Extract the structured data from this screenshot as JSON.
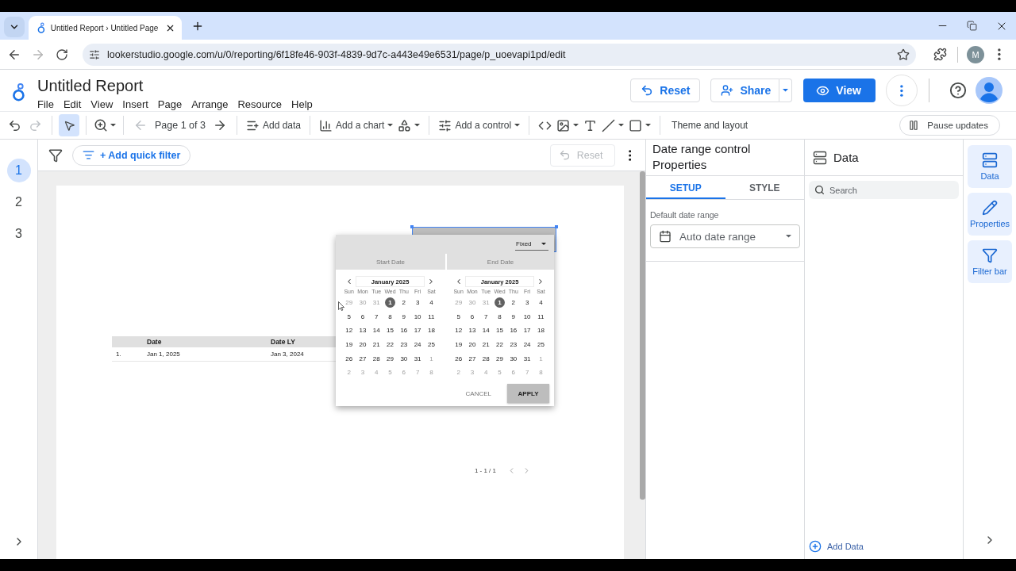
{
  "browser": {
    "tab_title": "Untitled Report › Untitled Page",
    "url": "lookerstudio.google.com/u/0/reporting/6f18fe46-903f-4839-9d7c-a443e49e6531/page/p_uoevapi1pd/edit",
    "profile": "M",
    "forward_disabled": true
  },
  "header": {
    "title": "Untitled Report",
    "menu": [
      "File",
      "Edit",
      "View",
      "Insert",
      "Page",
      "Arrange",
      "Resource",
      "Help"
    ],
    "actions": [
      {
        "kind": "reset",
        "label": "Reset"
      },
      {
        "kind": "share",
        "label": "Share"
      },
      {
        "kind": "view",
        "label": "View"
      }
    ]
  },
  "toolbar": {
    "history": [
      {
        "kind": "undo",
        "disabled": false
      },
      {
        "kind": "redo",
        "disabled": true
      }
    ],
    "select": {
      "selected": true
    },
    "pager": {
      "label": "Page 1 of 3",
      "prev_disabled": true,
      "next_disabled": false
    },
    "insert_groups": [
      [
        {
          "kind": "add-data",
          "label": "Add data",
          "caret": false
        }
      ],
      [
        {
          "kind": "chart",
          "label": "Add a chart",
          "caret": true
        },
        {
          "kind": "components",
          "caret": true
        }
      ],
      [
        {
          "kind": "control",
          "label": "Add a control",
          "caret": true
        }
      ],
      [
        {
          "kind": "embed",
          "caret": false
        },
        {
          "kind": "image",
          "caret": true
        },
        {
          "kind": "text",
          "caret": false
        },
        {
          "kind": "line",
          "caret": true
        },
        {
          "kind": "shape",
          "caret": true
        }
      ]
    ],
    "theme": "Theme and layout",
    "pause": "Pause updates"
  },
  "pages": [
    {
      "label": "1",
      "selected": true
    },
    {
      "label": "2",
      "selected": false
    },
    {
      "label": "3",
      "selected": false
    }
  ],
  "filter_bar": {
    "add_filter": "+ Add quick filter",
    "reset": {
      "label": "Reset",
      "disabled": true
    }
  },
  "report": {
    "table": {
      "columns": [
        "Date",
        "Date LY"
      ],
      "rows": [
        {
          "index": "1.",
          "cells": [
            "Jan 1, 2025",
            "Jan 3, 2024"
          ]
        }
      ],
      "pagination": "1 - 1 / 1"
    },
    "date_control": {
      "selected": true
    },
    "date_picker": {
      "mode": "Fixed",
      "calendars": [
        {
          "heading": "Start Date",
          "month": "January 2025",
          "weekdays": [
            "Sun",
            "Mon",
            "Tue",
            "Wed",
            "Thu",
            "Fri",
            "Sat"
          ],
          "weeks": [
            [
              {
                "label": "29",
                "muted": true,
                "selected": false
              },
              {
                "label": "30",
                "muted": true,
                "selected": false
              },
              {
                "label": "31",
                "muted": true,
                "selected": false
              },
              {
                "label": "1",
                "muted": false,
                "selected": true
              },
              {
                "label": "2",
                "muted": false,
                "selected": false
              },
              {
                "label": "3",
                "muted": false,
                "selected": false
              },
              {
                "label": "4",
                "muted": false,
                "selected": false
              }
            ],
            [
              {
                "label": "5",
                "muted": false,
                "selected": false
              },
              {
                "label": "6",
                "muted": false,
                "selected": false
              },
              {
                "label": "7",
                "muted": false,
                "selected": false
              },
              {
                "label": "8",
                "muted": false,
                "selected": false
              },
              {
                "label": "9",
                "muted": false,
                "selected": false
              },
              {
                "label": "10",
                "muted": false,
                "selected": false
              },
              {
                "label": "11",
                "muted": false,
                "selected": false
              }
            ],
            [
              {
                "label": "12",
                "muted": false,
                "selected": false
              },
              {
                "label": "13",
                "muted": false,
                "selected": false
              },
              {
                "label": "14",
                "muted": false,
                "selected": false
              },
              {
                "label": "15",
                "muted": false,
                "selected": false
              },
              {
                "label": "16",
                "muted": false,
                "selected": false
              },
              {
                "label": "17",
                "muted": false,
                "selected": false
              },
              {
                "label": "18",
                "muted": false,
                "selected": false
              }
            ],
            [
              {
                "label": "19",
                "muted": false,
                "selected": false
              },
              {
                "label": "20",
                "muted": false,
                "selected": false
              },
              {
                "label": "21",
                "muted": false,
                "selected": false
              },
              {
                "label": "22",
                "muted": false,
                "selected": false
              },
              {
                "label": "23",
                "muted": false,
                "selected": false
              },
              {
                "label": "24",
                "muted": false,
                "selected": false
              },
              {
                "label": "25",
                "muted": false,
                "selected": false
              }
            ],
            [
              {
                "label": "26",
                "muted": false,
                "selected": false
              },
              {
                "label": "27",
                "muted": false,
                "selected": false
              },
              {
                "label": "28",
                "muted": false,
                "selected": false
              },
              {
                "label": "29",
                "muted": false,
                "selected": false
              },
              {
                "label": "30",
                "muted": false,
                "selected": false
              },
              {
                "label": "31",
                "muted": false,
                "selected": false
              },
              {
                "label": "1",
                "muted": true,
                "selected": false
              }
            ],
            [
              {
                "label": "2",
                "muted": true,
                "selected": false
              },
              {
                "label": "3",
                "muted": true,
                "selected": false
              },
              {
                "label": "4",
                "muted": true,
                "selected": false
              },
              {
                "label": "5",
                "muted": true,
                "selected": false
              },
              {
                "label": "6",
                "muted": true,
                "selected": false
              },
              {
                "label": "7",
                "muted": true,
                "selected": false
              },
              {
                "label": "8",
                "muted": true,
                "selected": false
              }
            ]
          ]
        },
        {
          "heading": "End Date",
          "month": "January 2025",
          "weekdays": [
            "Sun",
            "Mon",
            "Tue",
            "Wed",
            "Thu",
            "Fri",
            "Sat"
          ],
          "weeks": [
            [
              {
                "label": "29",
                "muted": true,
                "selected": false
              },
              {
                "label": "30",
                "muted": true,
                "selected": false
              },
              {
                "label": "31",
                "muted": true,
                "selected": false
              },
              {
                "label": "1",
                "muted": false,
                "selected": true
              },
              {
                "label": "2",
                "muted": false,
                "selected": false
              },
              {
                "label": "3",
                "muted": false,
                "selected": false
              },
              {
                "label": "4",
                "muted": false,
                "selected": false
              }
            ],
            [
              {
                "label": "5",
                "muted": false,
                "selected": false
              },
              {
                "label": "6",
                "muted": false,
                "selected": false
              },
              {
                "label": "7",
                "muted": false,
                "selected": false
              },
              {
                "label": "8",
                "muted": false,
                "selected": false
              },
              {
                "label": "9",
                "muted": false,
                "selected": false
              },
              {
                "label": "10",
                "muted": false,
                "selected": false
              },
              {
                "label": "11",
                "muted": false,
                "selected": false
              }
            ],
            [
              {
                "label": "12",
                "muted": false,
                "selected": false
              },
              {
                "label": "13",
                "muted": false,
                "selected": false
              },
              {
                "label": "14",
                "muted": false,
                "selected": false
              },
              {
                "label": "15",
                "muted": false,
                "selected": false
              },
              {
                "label": "16",
                "muted": false,
                "selected": false
              },
              {
                "label": "17",
                "muted": false,
                "selected": false
              },
              {
                "label": "18",
                "muted": false,
                "selected": false
              }
            ],
            [
              {
                "label": "19",
                "muted": false,
                "selected": false
              },
              {
                "label": "20",
                "muted": false,
                "selected": false
              },
              {
                "label": "21",
                "muted": false,
                "selected": false
              },
              {
                "label": "22",
                "muted": false,
                "selected": false
              },
              {
                "label": "23",
                "muted": false,
                "selected": false
              },
              {
                "label": "24",
                "muted": false,
                "selected": false
              },
              {
                "label": "25",
                "muted": false,
                "selected": false
              }
            ],
            [
              {
                "label": "26",
                "muted": false,
                "selected": false
              },
              {
                "label": "27",
                "muted": false,
                "selected": false
              },
              {
                "label": "28",
                "muted": false,
                "selected": false
              },
              {
                "label": "29",
                "muted": false,
                "selected": false
              },
              {
                "label": "30",
                "muted": false,
                "selected": false
              },
              {
                "label": "31",
                "muted": false,
                "selected": false
              },
              {
                "label": "1",
                "muted": true,
                "selected": false
              }
            ],
            [
              {
                "label": "2",
                "muted": true,
                "selected": false
              },
              {
                "label": "3",
                "muted": true,
                "selected": false
              },
              {
                "label": "4",
                "muted": true,
                "selected": false
              },
              {
                "label": "5",
                "muted": true,
                "selected": false
              },
              {
                "label": "6",
                "muted": true,
                "selected": false
              },
              {
                "label": "7",
                "muted": true,
                "selected": false
              },
              {
                "label": "8",
                "muted": true,
                "selected": false
              }
            ]
          ]
        }
      ],
      "cancel": "CANCEL",
      "apply": "APPLY"
    }
  },
  "properties": {
    "title": "Date range control Properties",
    "tabs": [
      {
        "label": "SETUP",
        "selected": true
      },
      {
        "label": "STYLE",
        "selected": false
      }
    ],
    "field_label": "Default date range",
    "value": "Auto date range"
  },
  "data_panel": {
    "title": "Data",
    "search_placeholder": "Search",
    "add_data": "Add Data"
  },
  "rail": [
    {
      "kind": "data",
      "label": "Data"
    },
    {
      "kind": "properties",
      "label": "Properties"
    },
    {
      "kind": "filter",
      "label": "Filter bar"
    }
  ]
}
